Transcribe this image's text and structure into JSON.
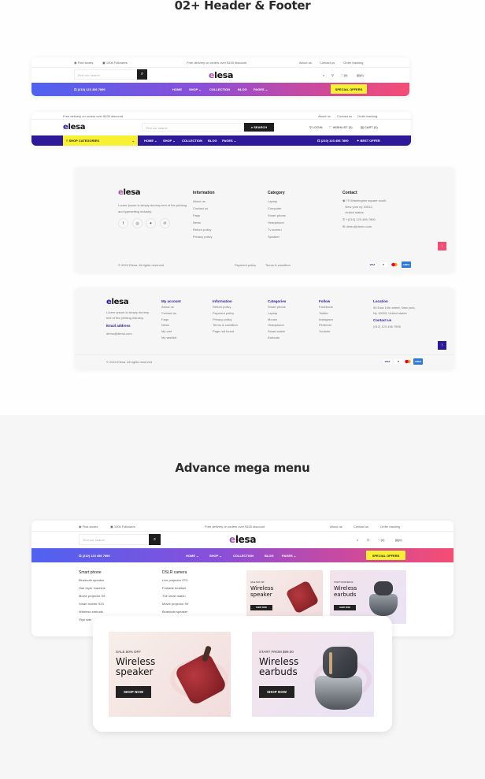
{
  "sections": {
    "header_footer_title": "02+ Header & Footer",
    "mega_menu_title": "Advance mega menu"
  },
  "header1": {
    "topbar": {
      "find_stores": "Find stores",
      "followers": "100k Followers",
      "promo": "Free delivery on orders over $100 discount",
      "links": [
        "About us",
        "Contact us",
        "Order tracking"
      ]
    },
    "search_placeholder": "Find our search",
    "logo": {
      "e": "e",
      "rest": "lesa"
    },
    "icons": {
      "wishlist_count": "(0)",
      "cart_count": "(0)"
    },
    "phone": "(210) 123 456 7890",
    "nav": [
      "HOME",
      "SHOP",
      "COLLECTION",
      "BLOG",
      "PAGES"
    ],
    "special_offers": "SPECIAL OFFERS",
    "colors": {
      "gradient_start": "#4f62f0",
      "gradient_end": "#f54c74",
      "special_bg": "#f7f033"
    }
  },
  "header2": {
    "topbar": {
      "promo": "Free delivery on orders over $100 discount.",
      "links": [
        "About us",
        "Contact us",
        "Order tracking"
      ]
    },
    "logo": {
      "e": "e",
      "rest": "lesa"
    },
    "search_placeholder": "Find our search",
    "search_button": "SEARCH",
    "login": "LOGIN",
    "wishlist": "WISHLIST (0)",
    "cart": "CART (0)",
    "shop_categories": "SHOP CATEGORIES",
    "nav": [
      "HOME",
      "SHOP",
      "COLLECTION",
      "BLOG",
      "PAGES"
    ],
    "phone": "(210) 123 456 7890",
    "best_offer": "BEST OFFER",
    "colors": {
      "nav_bg": "#2e1a99"
    }
  },
  "footer1": {
    "logo": {
      "e": "e",
      "rest": "lesa"
    },
    "about": "Lorem Ipsum is simply dummy text of the printing and typesetting industry.",
    "social": [
      "facebook",
      "instagram",
      "twitter",
      "pinterest"
    ],
    "information": {
      "title": "Information",
      "items": [
        "About us",
        "Contact us",
        "Faqs",
        "News",
        "Return policy",
        "Privacy policy"
      ]
    },
    "category": {
      "title": "Category",
      "items": [
        "Laptop",
        "Computer",
        "Smart phone",
        "Headphone",
        "Tv screen",
        "Speaker"
      ]
    },
    "contact": {
      "title": "Contact",
      "address_line1": "70 Washington square south,",
      "address_line2": "New york ny 10012,",
      "address_line3": "United states",
      "phone": "+(210) 123 456 7890",
      "email": "demo@demo.com"
    },
    "copyright": "© 2024 Elesa. All rights reserved",
    "bottom_links": [
      "Payment policy",
      "Terms & condition"
    ],
    "payments": [
      "VISA",
      "P",
      "MC",
      "AMEX"
    ]
  },
  "footer2": {
    "logo": {
      "e": "e",
      "rest": "lesa"
    },
    "about": "Lorem Ipsum is simply dummy text of the printing industry.",
    "email_title": "Email address",
    "email": "demo@demo.com",
    "my_account": {
      "title": "My account",
      "items": [
        "About us",
        "Contact us",
        "Faqs",
        "News",
        "My cart",
        "My wishlist"
      ]
    },
    "information": {
      "title": "Information",
      "items": [
        "Return policy",
        "Payment policy",
        "Privacy policy",
        "Terms & condition",
        "Page not found"
      ]
    },
    "categories": {
      "title": "Categories",
      "items": [
        "Smart phone",
        "Laptop",
        "Mouse",
        "Headphone",
        "Smart watch",
        "Earbuds"
      ]
    },
    "follow": {
      "title": "Follow",
      "items": [
        "Facebook",
        "Twitter",
        "Instagram",
        "Pinterest",
        "Youtube"
      ]
    },
    "location": {
      "title": "Location",
      "line1": "55 East 10th street, New york,",
      "line2": "Ny 10003, United states"
    },
    "contact": {
      "title": "Contact us",
      "phone": "(012) 123 456 7890"
    },
    "copyright": "© 2024 Elesa. All rights reserved",
    "payments": [
      "VISA",
      "P",
      "MC",
      "AMEX"
    ]
  },
  "mega": {
    "topbar": {
      "find_stores": "Find stores",
      "followers": "100k Followers",
      "promo": "Free delivery on orders over $100 discount",
      "links": [
        "About us",
        "Contact us",
        "Order tracking"
      ]
    },
    "search_placeholder": "Find our search",
    "logo": {
      "e": "e",
      "rest": "lesa"
    },
    "icons": {
      "wishlist_count": "(0)",
      "cart_count": "(0)"
    },
    "phone": "(210) 123 456 7890",
    "nav": [
      "HOME",
      "SHOP",
      "COLLECTION",
      "BLOG",
      "PAGES"
    ],
    "special_offers": "SPECIAL OFFERS",
    "col1": {
      "title": "Smart phone",
      "items": [
        "Bluetooth speaker",
        "Hair dryer machine",
        "Movie projector S9",
        "Smart mobile S20",
        "Wireless earbuds",
        "Vigo side"
      ]
    },
    "col2": {
      "title": "DSLR camera",
      "items": [
        "Live projector ST0",
        "Portable headset",
        "The smart watch",
        "Movie projector S9",
        "Bluetooth speaker"
      ]
    },
    "promos": [
      {
        "pre": "SALE 50% OFF",
        "title1": "Wireless",
        "title2": "speaker",
        "button": "SHOP NOW"
      },
      {
        "pre": "START FROM $99.00",
        "title1": "Wireless",
        "title2": "earbuds",
        "button": "SHOP NOW"
      }
    ]
  }
}
